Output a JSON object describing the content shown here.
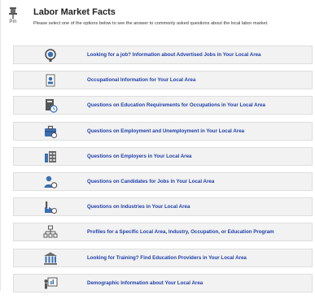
{
  "header": {
    "pin_label": "Pin",
    "title": "Labor Market Facts",
    "subtitle": "Please select one of the options below to see the answer to commonly asked questions about the local labor market."
  },
  "options": [
    {
      "label": "Looking for a job? Information about Advertised Jobs in Your Local Area",
      "icon": "magnifier-icon"
    },
    {
      "label": "Occupational Information for Your Local Area",
      "icon": "occupation-badge-icon"
    },
    {
      "label": "Questions on Education Requirements for Occupations in Your Local Area",
      "icon": "education-books-icon"
    },
    {
      "label": "Questions on Employment and Unemployment in Your Local Area",
      "icon": "briefcase-icon"
    },
    {
      "label": "Questions on Employers in Your Local Area",
      "icon": "employers-buildings-icon"
    },
    {
      "label": "Questions on Candidates for Jobs in Your Local Area",
      "icon": "candidate-person-icon"
    },
    {
      "label": "Questions on Industries in Your Local Area",
      "icon": "factory-icon"
    },
    {
      "label": "Profiles for a Specific Local Area, Industry, Occupation, or Education Program",
      "icon": "org-chart-icon"
    },
    {
      "label": "Looking for Training? Find Education Providers in Your Local Area",
      "icon": "school-building-icon"
    },
    {
      "label": "Demographic Information about Your Local Area",
      "icon": "presentation-icon"
    }
  ],
  "colors": {
    "link": "#1e3ea8",
    "row_bg": "#f2f2f2",
    "icon_blue": "#3a6fb0",
    "icon_gray": "#6b6b6b"
  }
}
